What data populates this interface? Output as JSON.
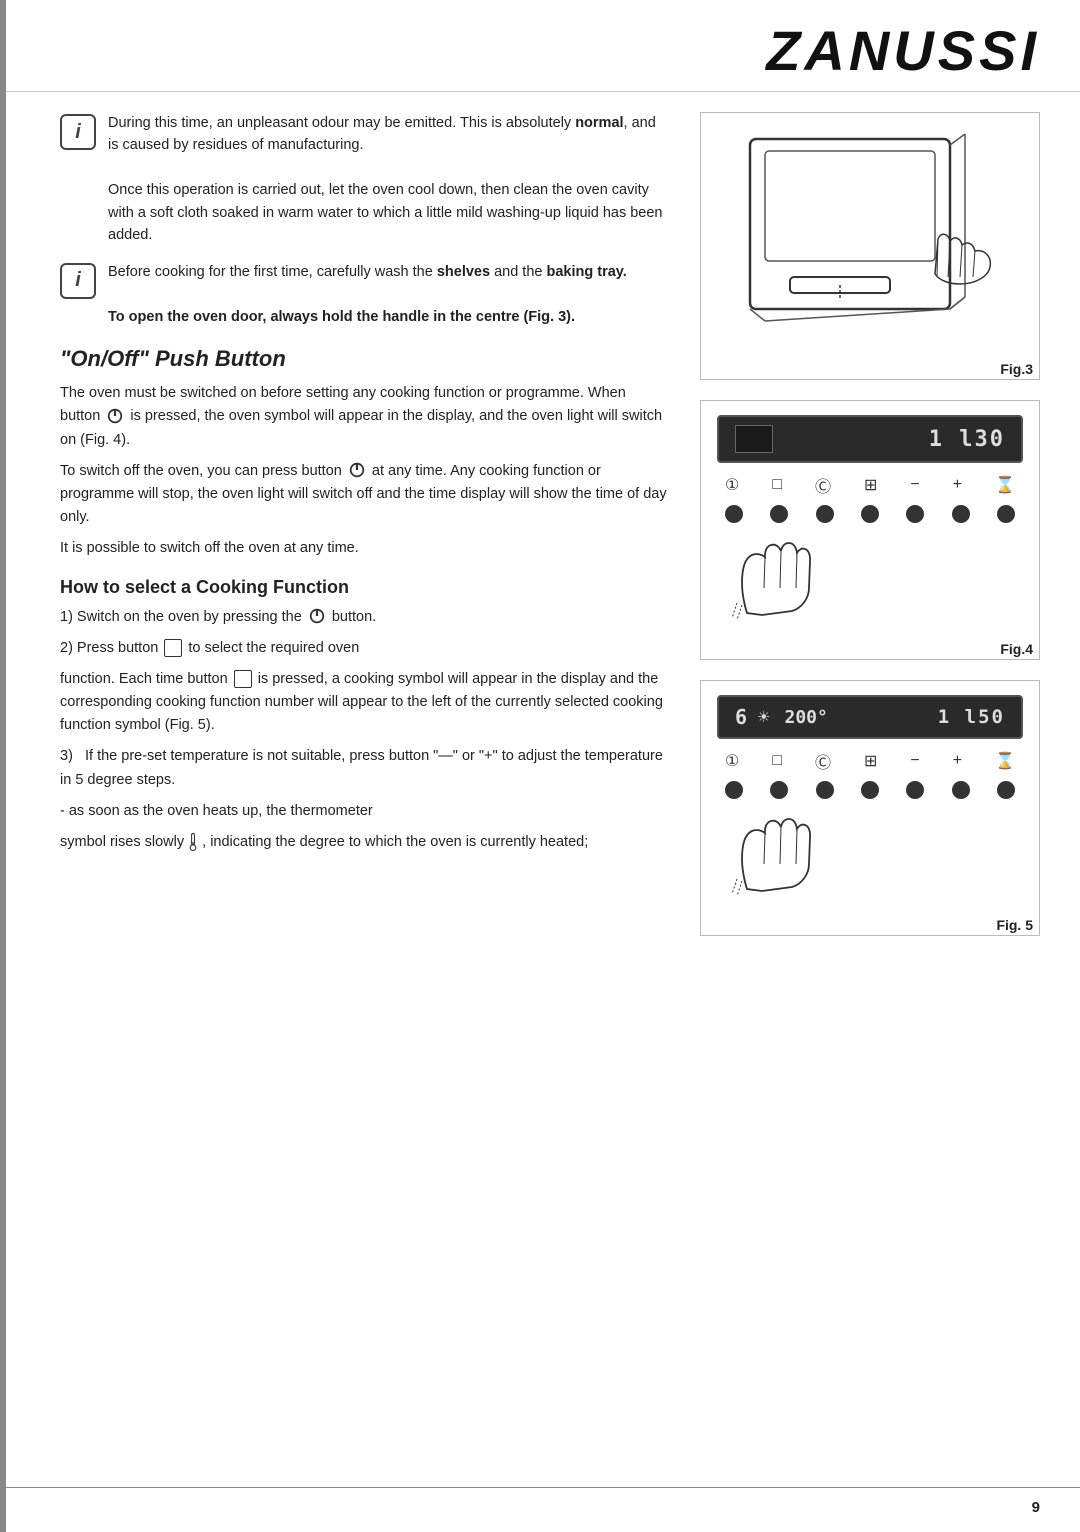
{
  "brand": "ZANUSSI",
  "page_number": "9",
  "info_block_1": {
    "icon": "i",
    "text_1": "During this time, an unpleasant odour may be emitted. This is absolutely",
    "bold_1": "normal",
    "text_2": ", and is caused by residues of manufacturing.",
    "text_3": "Once this operation is carried out, let the oven cool down, then clean the oven cavity with a soft cloth soaked in warm water to which a little mild washing-up liquid has been added."
  },
  "info_block_2": {
    "icon": "i",
    "text_1": "Before cooking for the first time, carefully wash the",
    "bold_1": "shelves",
    "text_2": "and the",
    "bold_2": "baking tray.",
    "bold_instruction": "To open the oven door, always hold the handle in the centre (Fig. 3)."
  },
  "section_onoff": {
    "heading": "\"On/Off\" Push Button",
    "para1": "The oven must be switched on before setting any cooking function or programme. When button",
    "para1_cont": "is pressed, the oven symbol will appear in the display, and the oven light will switch on (Fig. 4).",
    "para2": "To switch off the oven, you can press button",
    "para2_cont": "at any time. Any cooking function or programme will stop, the oven light will switch off and the time display will show the time of day only.",
    "para3": "It is possible to switch off the oven at any time."
  },
  "section_cooking": {
    "heading": "How to select a Cooking Function",
    "step1": "1) Switch on the oven by pressing the",
    "step1_cont": "button.",
    "step2": "2) Press button",
    "step2_cont": "to select the required oven",
    "step3": "function. Each time button",
    "step3_cont": "is pressed, a cooking symbol will appear in the display and the corresponding cooking function number will appear to the left of the currently selected cooking function symbol (Fig. 5).",
    "step4": "3)   If the pre-set temperature is not suitable, press button “—” or “+” to adjust the temperature in 5 degree steps.",
    "step5": "- as soon as the oven heats up, the thermometer",
    "step6": "symbol rises slowly",
    "step6_cont": ", indicating the degree to which the oven is currently heated;"
  },
  "figures": {
    "fig3_label": "Fig.3",
    "fig4_label": "Fig.4",
    "fig5_label": "Fig. 5",
    "fig4_display": {
      "time": "1 l30",
      "buttons": [
        "①",
        "□",
        "Ⓑ",
        "⊞",
        "−",
        "+",
        "⌛"
      ]
    },
    "fig5_display": {
      "num": "6",
      "icon": "🔥",
      "temp": "200°",
      "time": "1 l50",
      "buttons": [
        "①",
        "□",
        "Ⓑ",
        "⊞",
        "−",
        "+",
        "⌛"
      ]
    }
  }
}
